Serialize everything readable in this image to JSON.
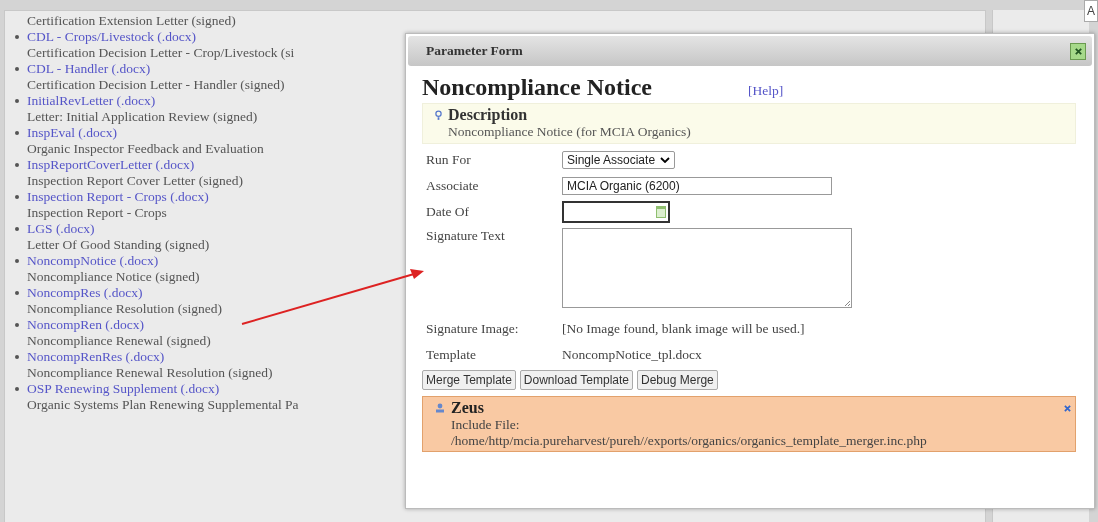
{
  "documents": [
    {
      "description": "Certification Extension Letter (signed)"
    },
    {
      "link": "CDL - Crops/Livestock (.docx)",
      "description": "Certification Decision Letter - Crop/Livestock (si"
    },
    {
      "link": "CDL - Handler (.docx)",
      "description": "Certification Decision Letter - Handler (signed)"
    },
    {
      "link": "InitialRevLetter (.docx)",
      "description": "Letter: Initial Application Review (signed)"
    },
    {
      "link": "InspEval (.docx)",
      "description": "Organic Inspector Feedback and Evaluation"
    },
    {
      "link": "InspReportCoverLetter (.docx)",
      "description": "Inspection Report Cover Letter (signed)"
    },
    {
      "link": "Inspection Report - Crops (.docx)",
      "description": "Inspection Report - Crops"
    },
    {
      "link": "LGS (.docx)",
      "description": "Letter Of Good Standing (signed)"
    },
    {
      "link": "NoncompNotice (.docx)",
      "description": "Noncompliance Notice (signed)"
    },
    {
      "link": "NoncompRes (.docx)",
      "description": "Noncompliance Resolution (signed)"
    },
    {
      "link": "NoncompRen (.docx)",
      "description": "Noncompliance Renewal (signed)"
    },
    {
      "link": "NoncompRenRes (.docx)",
      "description": "Noncompliance Renewal Resolution (signed)"
    },
    {
      "link": "OSP Renewing Supplement (.docx)",
      "description": "Organic Systems Plan Renewing Supplemental Pa"
    }
  ],
  "corner_tab": "A",
  "dialog": {
    "title": "Parameter Form",
    "heading": "Noncompliance Notice",
    "help_link": "[Help]",
    "description": {
      "title": "Description",
      "text": "Noncompliance Notice (for MCIA Organics)"
    },
    "fields": [
      {
        "kind": "select",
        "label": "Run For",
        "value": "Single Associate"
      },
      {
        "kind": "text",
        "label": "Associate",
        "value": "MCIA Organic (6200)"
      },
      {
        "kind": "date",
        "label": "Date Of"
      },
      {
        "kind": "textarea",
        "label": "Signature Text"
      },
      {
        "kind": "info",
        "label": "Signature Image:",
        "value": "[No Image found, blank image will be used.]"
      },
      {
        "kind": "info",
        "label": "Template",
        "value": "NoncompNotice_tpl.docx"
      }
    ],
    "buttons": [
      "Merge Template",
      "Download Template",
      "Debug Merge"
    ],
    "notice": {
      "title": "Zeus",
      "lines": [
        "Include File:",
        "/home/http/mcia.pureharvest/pureh//exports/organics/organics_template_merger.inc.php"
      ]
    }
  }
}
